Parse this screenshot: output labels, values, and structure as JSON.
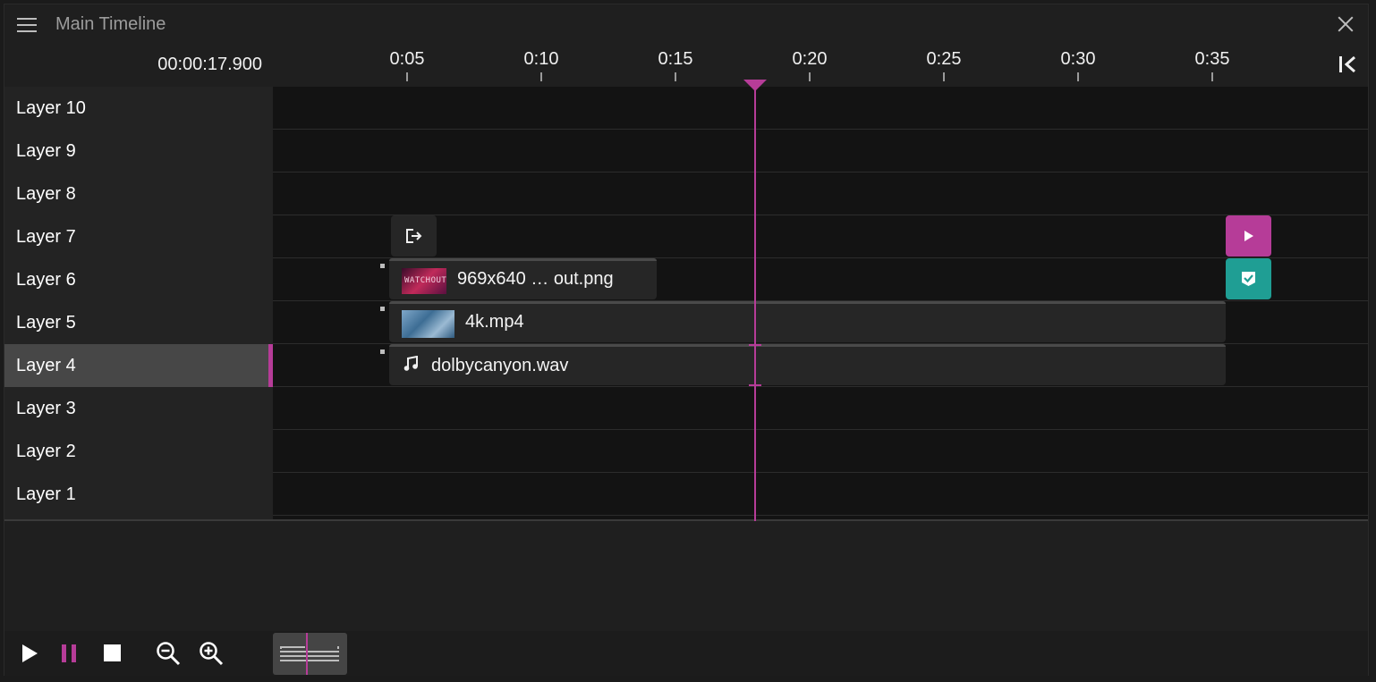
{
  "window": {
    "title": "Main Timeline"
  },
  "timecode": "00:00:17.900",
  "ruler": {
    "ticks": [
      "0:05",
      "0:10",
      "0:15",
      "0:20",
      "0:25",
      "0:30",
      "0:35"
    ]
  },
  "layers": [
    "Layer 10",
    "Layer 9",
    "Layer 8",
    "Layer 7",
    "Layer 6",
    "Layer 5",
    "Layer 4",
    "Layer 3",
    "Layer 2",
    "Layer 1"
  ],
  "selected_layer": "Layer 4",
  "clips": {
    "image": {
      "name": "969x640 … out.png",
      "thumb_text": "WATCHOUT"
    },
    "video": {
      "name": "4k.mp4"
    },
    "audio": {
      "name": "dolbycanyon.wav"
    }
  },
  "cues": {
    "play_color": "#b63c98",
    "check_color": "#1f9e94"
  },
  "colors": {
    "accent": "#b63c98",
    "background": "#131313",
    "layer_panel": "#232323"
  },
  "icons": [
    "menu-icon",
    "close-icon",
    "collapse-to-start-icon",
    "output-cue-icon",
    "play-cue-icon",
    "check-cue-icon",
    "music-note-icon",
    "play-icon",
    "pause-icon",
    "stop-icon",
    "zoom-out-icon",
    "zoom-in-icon"
  ]
}
